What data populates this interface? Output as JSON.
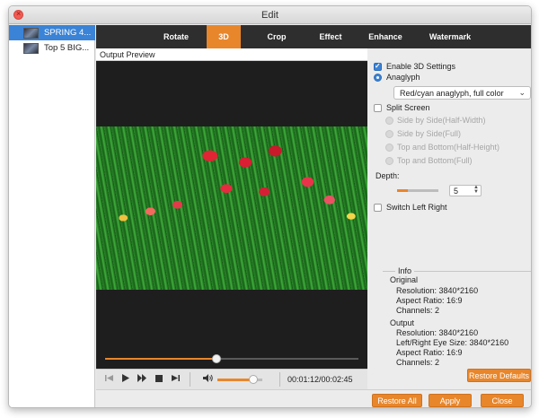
{
  "window": {
    "title": "Edit"
  },
  "sidebar": {
    "items": [
      {
        "name": "SPRING 4...",
        "selected": true
      },
      {
        "name": "Top 5 BIG...",
        "selected": false
      }
    ]
  },
  "tabs": [
    {
      "label": "Rotate",
      "active": false
    },
    {
      "label": "3D",
      "active": true
    },
    {
      "label": "Crop",
      "active": false
    },
    {
      "label": "Effect",
      "active": false
    },
    {
      "label": "Enhance",
      "active": false
    },
    {
      "label": "Watermark",
      "active": false
    }
  ],
  "preview": {
    "label": "Output Preview",
    "progress": 0.44,
    "volume": 0.8,
    "current_time": "00:01:12",
    "total_time": "00:02:45",
    "timecode": "00:01:12/00:02:45"
  },
  "settings": {
    "enable_3d_label": "Enable 3D Settings",
    "enable_3d_checked": true,
    "anaglyph_label": "Anaglyph",
    "anaglyph_selected": true,
    "anaglyph_mode": "Red/cyan anaglyph, full color",
    "split_screen_label": "Split Screen",
    "split_options": [
      "Side by Side(Half-Width)",
      "Side by Side(Full)",
      "Top and Bottom(Half-Height)",
      "Top and Bottom(Full)"
    ],
    "depth_label": "Depth:",
    "depth_value": "5",
    "switch_label": "Switch Left Right"
  },
  "info": {
    "title": "Info",
    "original_label": "Original",
    "original": {
      "resolution": "Resolution: 3840*2160",
      "aspect": "Aspect Ratio: 16:9",
      "channels": "Channels: 2"
    },
    "output_label": "Output",
    "output": {
      "resolution": "Resolution: 3840*2160",
      "eye_size": "Left/Right Eye Size: 3840*2160",
      "aspect": "Aspect Ratio: 16:9",
      "channels": "Channels: 2"
    }
  },
  "buttons": {
    "restore_defaults": "Restore Defaults",
    "restore_all": "Restore All",
    "apply": "Apply",
    "close": "Close"
  },
  "colors": {
    "accent": "#e8862b",
    "selection": "#3a83d6",
    "tabbar": "#2e2e2e"
  },
  "icons": {
    "skip_back": "skip-back-icon",
    "play": "play-icon",
    "fast_forward": "fast-forward-icon",
    "stop": "stop-icon",
    "skip_forward": "skip-forward-icon",
    "volume": "volume-icon"
  }
}
